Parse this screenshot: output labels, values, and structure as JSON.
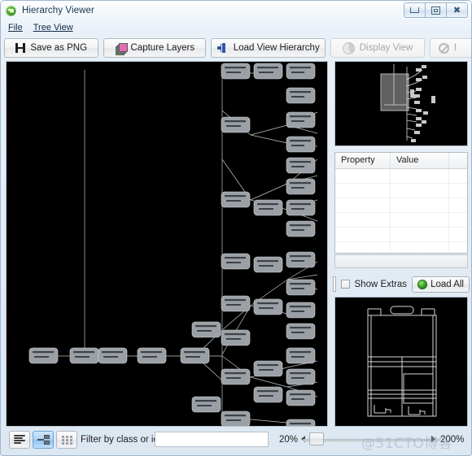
{
  "window": {
    "title": "Hierarchy Viewer",
    "app_icon": "android-green-icon",
    "controls": {
      "minimize": "minimize-icon",
      "maximize": "maximize-icon",
      "close": "close-icon"
    }
  },
  "menubar": {
    "items": [
      {
        "label": "File",
        "mnemonic": "F"
      },
      {
        "label": "Tree View",
        "mnemonic": "T"
      }
    ]
  },
  "toolbar": {
    "buttons": [
      {
        "label": "Save as PNG",
        "icon": "save-icon",
        "enabled": true,
        "mnemonic": ""
      },
      {
        "label": "Capture Layers",
        "icon": "layers-icon",
        "enabled": true,
        "mnemonic": "C"
      },
      {
        "label": "Load View Hierarchy",
        "icon": "hierarchy-icon",
        "enabled": true,
        "mnemonic": "H"
      },
      {
        "label": "Display View",
        "icon": "display-icon",
        "enabled": false,
        "mnemonic": "D"
      },
      {
        "label": "I",
        "icon": "invalidate-icon",
        "enabled": false,
        "mnemonic": "I"
      }
    ]
  },
  "property_panel": {
    "columns": [
      "Property",
      "Value"
    ],
    "rows": [
      [
        "",
        ""
      ],
      [
        "",
        ""
      ],
      [
        "",
        ""
      ],
      [
        "",
        ""
      ],
      [
        "",
        ""
      ],
      [
        "",
        ""
      ]
    ]
  },
  "extras_bar": {
    "color_swatch": "#ffffff",
    "show_extras_label": "Show Extras",
    "show_extras_checked": false,
    "load_all_label": "Load All",
    "load_all_icon": "globe-icon"
  },
  "bottom_bar": {
    "view_modes": [
      {
        "name": "list-view",
        "icon": "lines-icon",
        "active": false
      },
      {
        "name": "tree-view",
        "icon": "nodes-icon",
        "active": true
      },
      {
        "name": "grid-view",
        "icon": "grid-icon",
        "active": false
      }
    ],
    "filter_label": "Filter by class or id:",
    "filter_value": "",
    "filter_placeholder": "",
    "zoom_min_label": "20%",
    "zoom_max_label": "200%",
    "zoom_current": 20
  },
  "watermark": {
    "text": "@51CTO博客"
  },
  "colors": {
    "canvas_background": "#000000",
    "node_fill": "#9aa0a6",
    "node_stroke": "#c9ced3",
    "edge": "#e8eaec",
    "accent_blue": "#2b4fa8",
    "selection_blue": "#a9d2f5",
    "window_chrome": "#dce7f2"
  }
}
